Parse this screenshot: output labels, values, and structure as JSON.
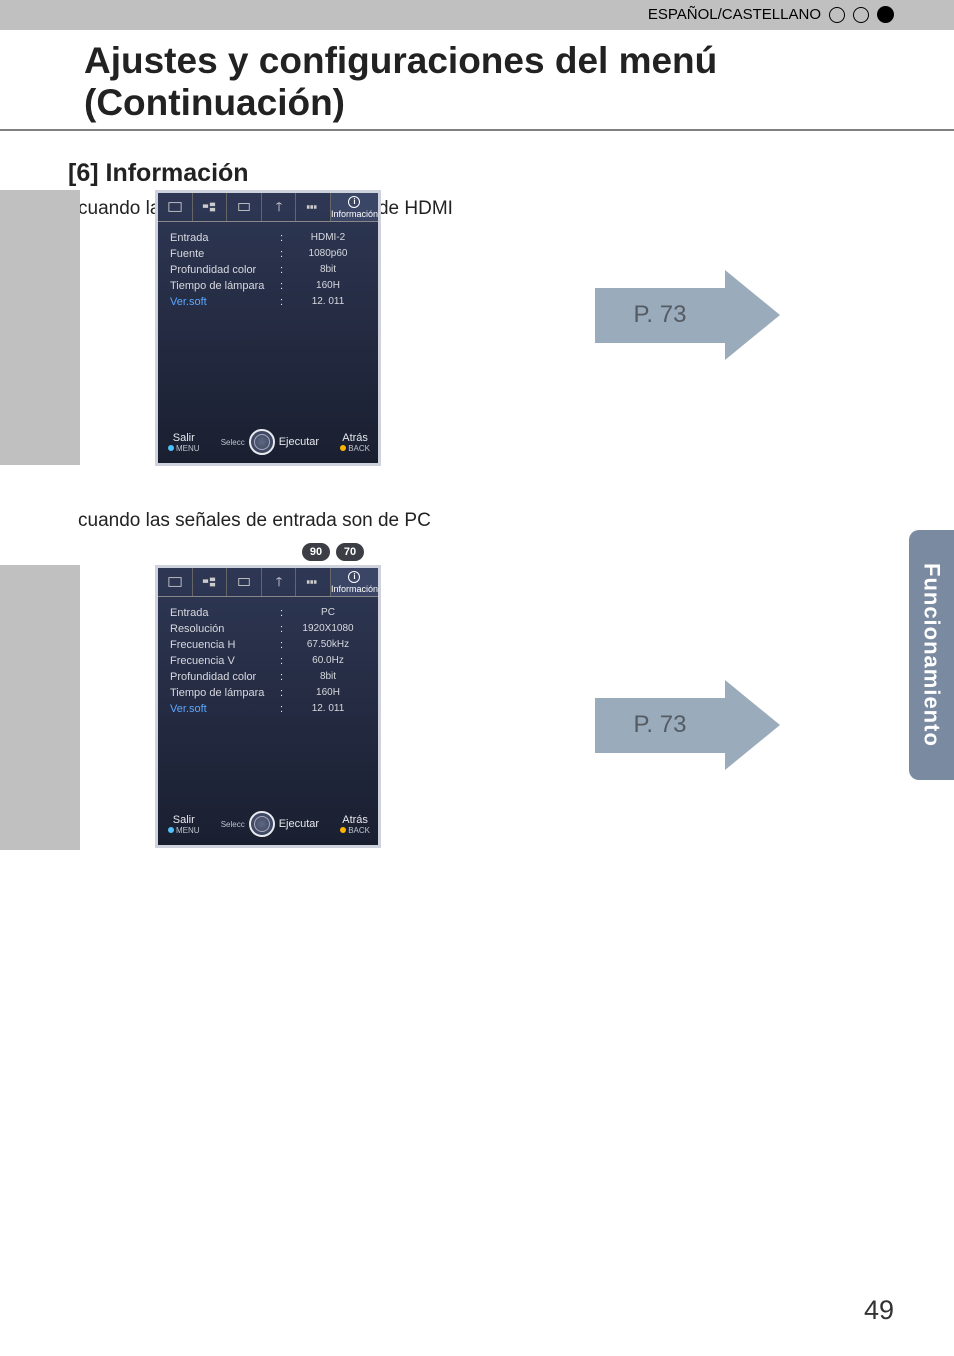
{
  "header": {
    "lang": "ESPAÑOL/CASTELLANO"
  },
  "title": "Ajustes y configuraciones del menú (Continuación)",
  "section": {
    "heading": "[6] Información"
  },
  "hdmi": {
    "subtitle": "cuando las señales de entrada son de HDMI",
    "tab_label": "Información",
    "rows": [
      {
        "label": "Entrada",
        "value": "HDMI-2"
      },
      {
        "label": "Fuente",
        "value": "1080p60"
      },
      {
        "label": "Profundidad color",
        "value": "8bit"
      },
      {
        "label": "Tiempo de lámpara",
        "value": "160H"
      },
      {
        "label": "Ver.soft",
        "value": "12. 011"
      }
    ],
    "footer": {
      "exit": "Salir",
      "menu": "MENU",
      "select": "Selecc",
      "exec": "Ejecutar",
      "back_top": "Atrás",
      "back_bot": "BACK"
    },
    "arrow": "P. 73"
  },
  "pc": {
    "subtitle": "cuando las señales de entrada son de PC",
    "badges": [
      "90",
      "70"
    ],
    "tab_label": "Información",
    "rows": [
      {
        "label": "Entrada",
        "value": "PC"
      },
      {
        "label": "Resolución",
        "value": "1920X1080"
      },
      {
        "label": "Frecuencia H",
        "value": "67.50kHz"
      },
      {
        "label": "Frecuencia V",
        "value": "60.0Hz"
      },
      {
        "label": "Profundidad color",
        "value": "8bit"
      },
      {
        "label": "Tiempo de lámpara",
        "value": "160H"
      },
      {
        "label": "Ver.soft",
        "value": "12. 011"
      }
    ],
    "footer": {
      "exit": "Salir",
      "menu": "MENU",
      "select": "Selecc",
      "exec": "Ejecutar",
      "back_top": "Atrás",
      "back_bot": "BACK"
    },
    "arrow": "P. 73"
  },
  "side_tab": "Funcionamiento",
  "page_number": "49"
}
